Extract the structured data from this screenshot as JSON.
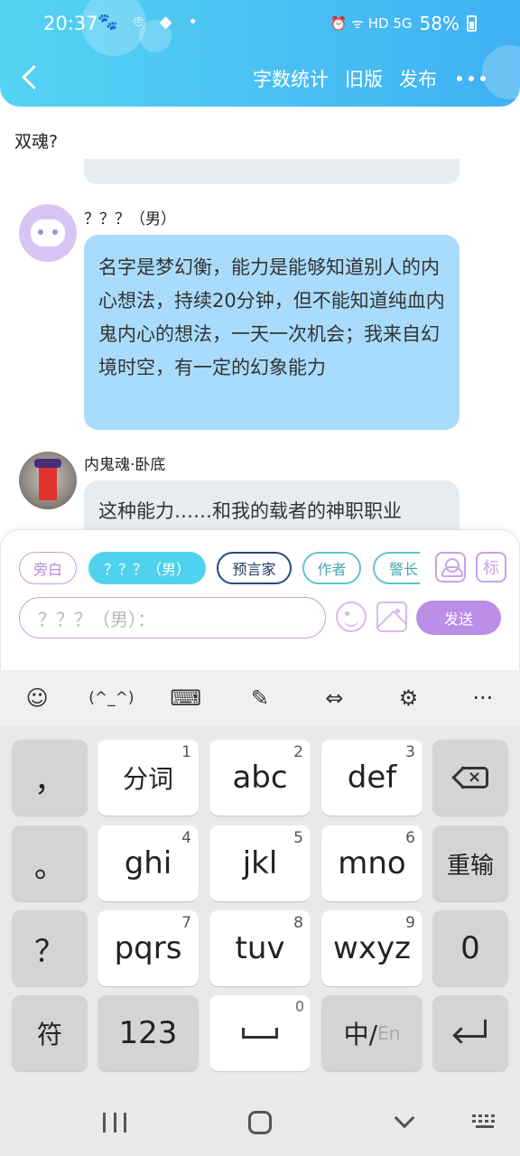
{
  "status_bar": {
    "time": "20:37",
    "left_icons": "🐾 ⌾ ◆ •",
    "right_icons": "⏰ ᯤ HD 5G",
    "battery": "58%"
  },
  "header": {
    "actions": [
      "字数统计",
      "旧版",
      "发布"
    ]
  },
  "chat": {
    "previous_text": "双魂?",
    "messages": [
      {
        "sender": "？？？（男）",
        "text": "名字是梦幻衡，能力是能够知道别人的内心想法，持续20分钟，但不能知道纯血内鬼内心的想法，一天一次机会；我来自幻境时空，有一定的幻象能力"
      },
      {
        "sender": "内鬼魂·卧底",
        "text": "这种能力……和我的载者的神职职业"
      }
    ]
  },
  "composer": {
    "roles": [
      "旁白",
      "？？？（男）",
      "预言家",
      "作者",
      "警长"
    ],
    "tag_label": "标",
    "input_value": "？？？（男）：",
    "send_label": "发送"
  },
  "keyboard": {
    "toolbar": [
      "(^_^)"
    ],
    "rows": [
      [
        {
          "label": "，"
        },
        {
          "label": "分词",
          "num": "1"
        },
        {
          "label": "abc",
          "num": "2"
        },
        {
          "label": "def",
          "num": "3"
        }
      ],
      [
        {
          "label": "。"
        },
        {
          "label": "ghi",
          "num": "4"
        },
        {
          "label": "jkl",
          "num": "5"
        },
        {
          "label": "mno",
          "num": "6"
        },
        {
          "label": "重输"
        }
      ],
      [
        {
          "label": "？"
        },
        {
          "label": "pqrs",
          "num": "7"
        },
        {
          "label": "tuv",
          "num": "8"
        },
        {
          "label": "wxyz",
          "num": "9"
        },
        {
          "label": "0"
        }
      ],
      [
        {
          "label": "符"
        },
        {
          "label": "123"
        },
        {
          "label": "中/"
        },
        {
          "label": "En"
        }
      ]
    ]
  },
  "colors": {
    "header_gradient_start": "#55d3f3",
    "header_gradient_end": "#3fb0f3",
    "bubble_blue": "#a9dcfc",
    "bubble_gray": "#e7ecf1",
    "send_button": "#bb8fe8",
    "active_chip": "#4fd2ee"
  }
}
